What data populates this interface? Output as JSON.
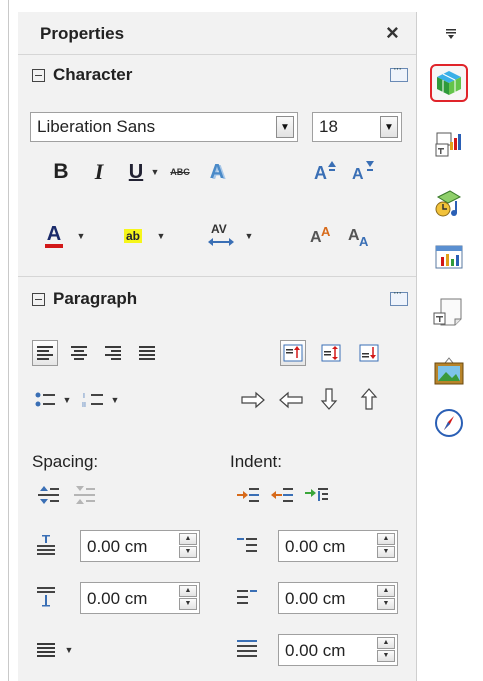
{
  "panel": {
    "title": "Properties",
    "close_glyph": "×"
  },
  "character": {
    "header": "Character",
    "font_name": "Liberation Sans",
    "font_size": "18",
    "buttons": {
      "bold": "B",
      "italic": "I",
      "underline": "U",
      "strikethrough": "ABC",
      "shadow": "A",
      "font_color": "A",
      "highlight": "ab",
      "spacing": "AV",
      "grow": "A",
      "shrink": "A"
    }
  },
  "paragraph": {
    "header": "Paragraph",
    "spacing_label": "Spacing:",
    "indent_label": "Indent:",
    "above_spacing": "0.00 cm",
    "below_spacing": "0.00 cm",
    "before_indent": "0.00 cm",
    "after_indent": "0.00 cm",
    "first_line_indent": "0.00 cm"
  },
  "sidebar": {
    "tabs": [
      "properties-tab",
      "styles-tab",
      "gallery-tab",
      "navigator-tab",
      "functions-tab",
      "navigator-compass-tab"
    ]
  },
  "colors": {
    "font_color_bar": "#d21818",
    "highlight": "#f6f61a",
    "selected_tab_border": "#e0242a"
  }
}
